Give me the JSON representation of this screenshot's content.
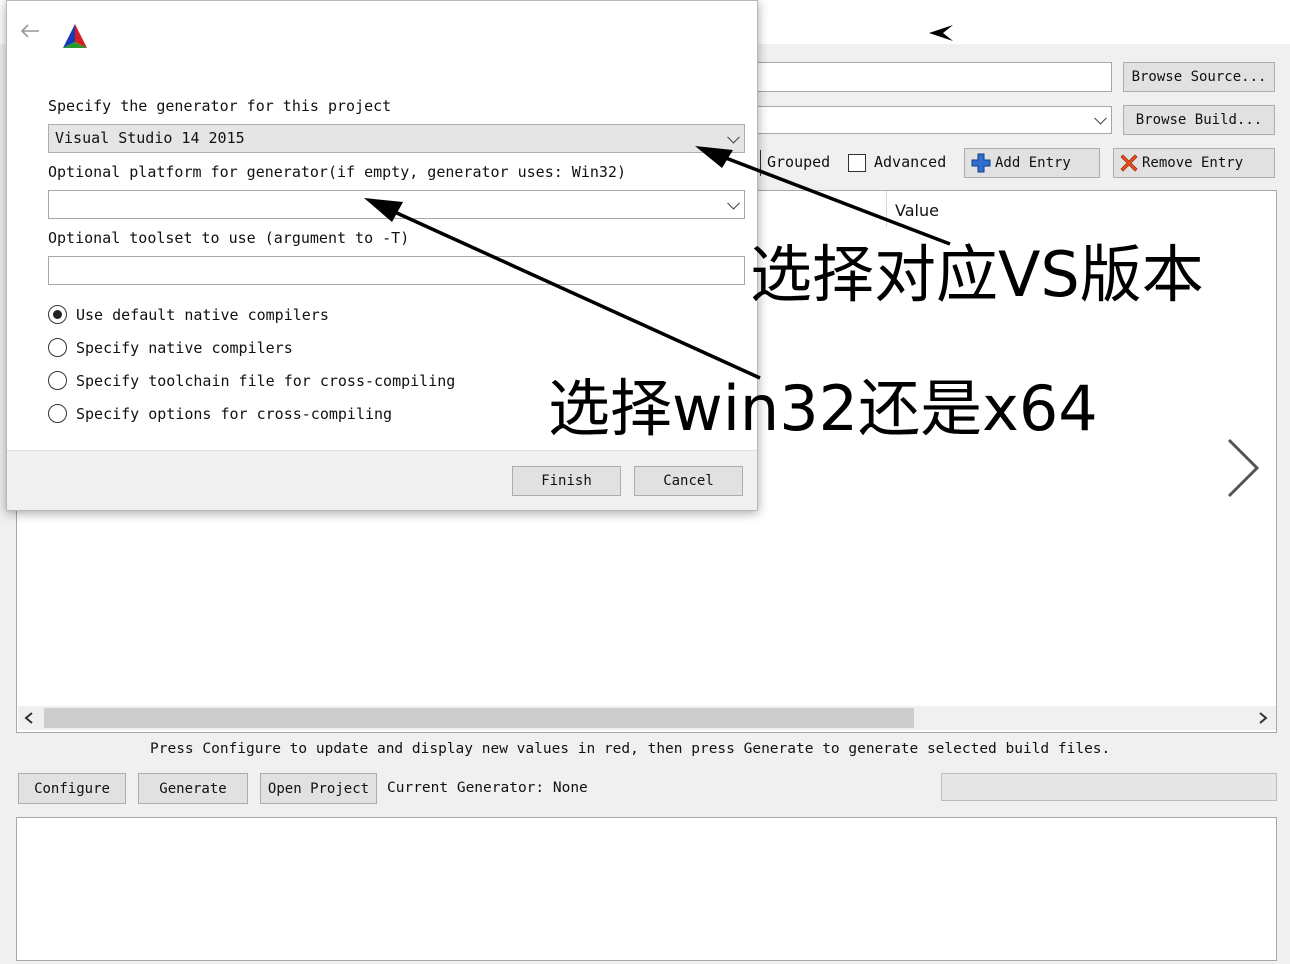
{
  "main": {
    "browse_source_label": "Browse Source...",
    "browse_build_label": "Browse Build...",
    "grouped_label": "Grouped",
    "advanced_label": "Advanced",
    "add_entry_label": "Add Entry",
    "remove_entry_label": "Remove Entry",
    "table_value_header": "Value",
    "hint_text": "Press Configure to update and display new values in red, then press Generate to generate selected build files.",
    "configure_label": "Configure",
    "generate_label": "Generate",
    "open_project_label": "Open Project",
    "current_generator": "Current Generator: None"
  },
  "dialog": {
    "generator_prompt": "Specify the generator for this project",
    "generator_value": "Visual Studio 14 2015",
    "platform_prompt": "Optional platform for generator(if empty, generator uses: Win32)",
    "platform_value": "",
    "toolset_prompt": "Optional toolset to use (argument to -T)",
    "toolset_value": "",
    "radio_options": [
      {
        "label": "Use default native compilers",
        "selected": true
      },
      {
        "label": "Specify native compilers",
        "selected": false
      },
      {
        "label": "Specify toolchain file for cross-compiling",
        "selected": false
      },
      {
        "label": "Specify options for cross-compiling",
        "selected": false
      }
    ],
    "finish_label": "Finish",
    "cancel_label": "Cancel"
  },
  "annotations": {
    "vs_version": "选择对应VS版本",
    "platform": "选择win32还是x64"
  },
  "icons": {
    "back": "back-arrow-icon",
    "app": "cmake-logo-icon",
    "add": "plus-icon",
    "remove": "remove-x-icon"
  },
  "colors": {
    "window_bg": "#f0f0f0",
    "add_icon": "#2f6fd0",
    "remove_icon": "#e05020",
    "annotation": "#000000"
  }
}
